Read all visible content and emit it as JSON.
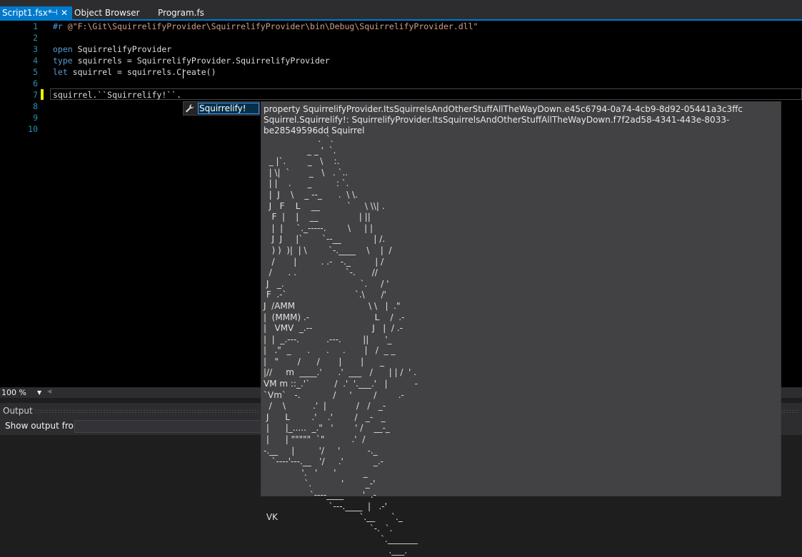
{
  "tabs": [
    {
      "label": "Script1.fsx*",
      "active": true,
      "pin_icon": "pin-icon",
      "close_icon": "close-icon"
    },
    {
      "label": "Object Browser",
      "active": false
    },
    {
      "label": "Program.fs",
      "active": false
    }
  ],
  "editor": {
    "line_numbers": [
      "1",
      "2",
      "3",
      "4",
      "5",
      "6",
      "7",
      "8",
      "9",
      "10"
    ],
    "lines": {
      "l1_kw": "#r ",
      "l1_str": "@\"F:\\Git\\SquirrelifyProvider\\SquirrelifyProvider\\bin\\Debug\\SquirrelifyProvider.dll\"",
      "l3_kw": "open",
      "l3_rest": " SquirrelifyProvider",
      "l4_kw": "type",
      "l4_rest": " squirrels = SquirrelifyProvider.SquirrelifyProvider",
      "l5_kw": "let",
      "l5_rest": " squirrel = squirrels.Create()",
      "l7": "squirrel.``Squirrelify!``",
      "l7_dot": "."
    },
    "current_line": "7"
  },
  "completion": {
    "item_label": "Squirrelify!",
    "item_icon": "wrench-icon"
  },
  "tooltip": {
    "signature": "property SquirrelifyProvider.ItsSquirrelsAndOtherStuffAllTheWayDown.e45c6794-0a74-4cb9-8d92-05441a3c3ffc Squirrel.Squirrelify!: SquirrelifyProvider.ItsSquirrelsAndOtherStuffAllTheWayDown.f7f2ad58-4341-443e-8033-be28549596dd Squirrel",
    "ascii_art": "                    .  `.\n                _ _ '  `.\n  _ |`.        _   \\    :.\n  | \\|  `       _   \\   . `..\n  | |    .      _         : `.\n  |  J    \\    _ --_      .  \\ \\.\n  J   F    L    __          `     \\ \\\\| .\n   F  |    |    __               | ||\n   |  |     `._-----.        \\     | |\n   J  J     |`       `--__            | /.\n   ) )  )|  | \\        `-.____    \\    |  /\n   /       |         . .-   -._         | /\n  /      . .                  `-.      //\n J   _.                            `.     / '\n F  .-`                         `.\\      /'\nJ  /AMM                           \\ \\   |  .\"\n|  (MMM) .-                        L    /  .-\n|   VMV  _.--                      J   |  / .-\n|  |  _.---.          .---.        ||      '_\n|   .\"  _      .      .     .       |   /  _ _\n|   \"       /      /       |       |      _\n|//     m  ____.'      .'  ___   /      | | /  ' .\nVM m ::_.'`         /  .'  '.___.'   |          -\n`Vm`   -.            /     '        /        .-\n  /    \\          .'  |           /   /   _-\n J      L        .'    .'        /   _-   _\n |      |_.....  _.\"   '        ' /    __-_\n |      | \"\"\"\"\"  `\"          .'  /\n-.__     |         '/     '          -._ \n   `----'---.__   '/     .'           _.-\n              '.   '      '          _ \n               `.           '        _-'\n                 `----____       '  .-\n                        `---.____  |   .-'\n VK                              `.__      `._\n                                       `-.  `.\n                                           `._______\n                                              .___."
  },
  "status": {
    "zoom": "100 %"
  },
  "output": {
    "title": "Output",
    "show_output_label": "Show output from:",
    "show_output_value": ""
  }
}
